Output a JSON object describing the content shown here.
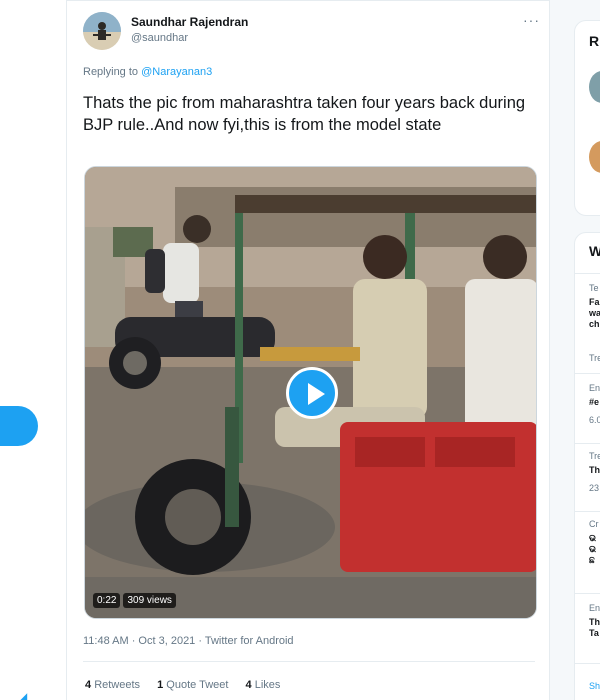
{
  "tweet": {
    "author_name": "Saundhar Rajendran",
    "author_handle": "@saundhar",
    "more_icon": "more-horizontal-icon",
    "reply_prefix": "Replying to",
    "reply_mention": "@Narayanan3",
    "text": "Thats the pic from maharashtra taken four years back during BJP rule..And now fyi,this is from the model state",
    "video": {
      "duration": "0:22",
      "views": "309 views",
      "play_icon": "play-icon"
    },
    "meta": "11:48 AM · Oct 3, 2021 · Twitter for Android",
    "stats": {
      "retweets_count": "4",
      "retweets_label": "Retweets",
      "quotes_count": "1",
      "quotes_label": "Quote Tweet",
      "likes_count": "4",
      "likes_label": "Likes"
    }
  },
  "right_sidebar": {
    "card1_head": "R",
    "card2_head": "W",
    "trends": [
      {
        "line1": "Te",
        "line2": "Fa\nwa\nch",
        "line3": "Tre"
      },
      {
        "line1": "En",
        "line2": "#e",
        "line3": "6.0"
      },
      {
        "line1": "Tre",
        "line2": "Th",
        "line3": "23"
      },
      {
        "line1": "Cr",
        "line2": "ଭ\nଭ\nଛ",
        "line3": ""
      },
      {
        "line1": "En",
        "line2": "Th\nTa",
        "line3": ""
      }
    ],
    "show_more": "Sh"
  },
  "colors": {
    "accent": "#1da1f2",
    "text_primary": "#14171a",
    "text_secondary": "#657786",
    "border": "#e6ecf0"
  }
}
